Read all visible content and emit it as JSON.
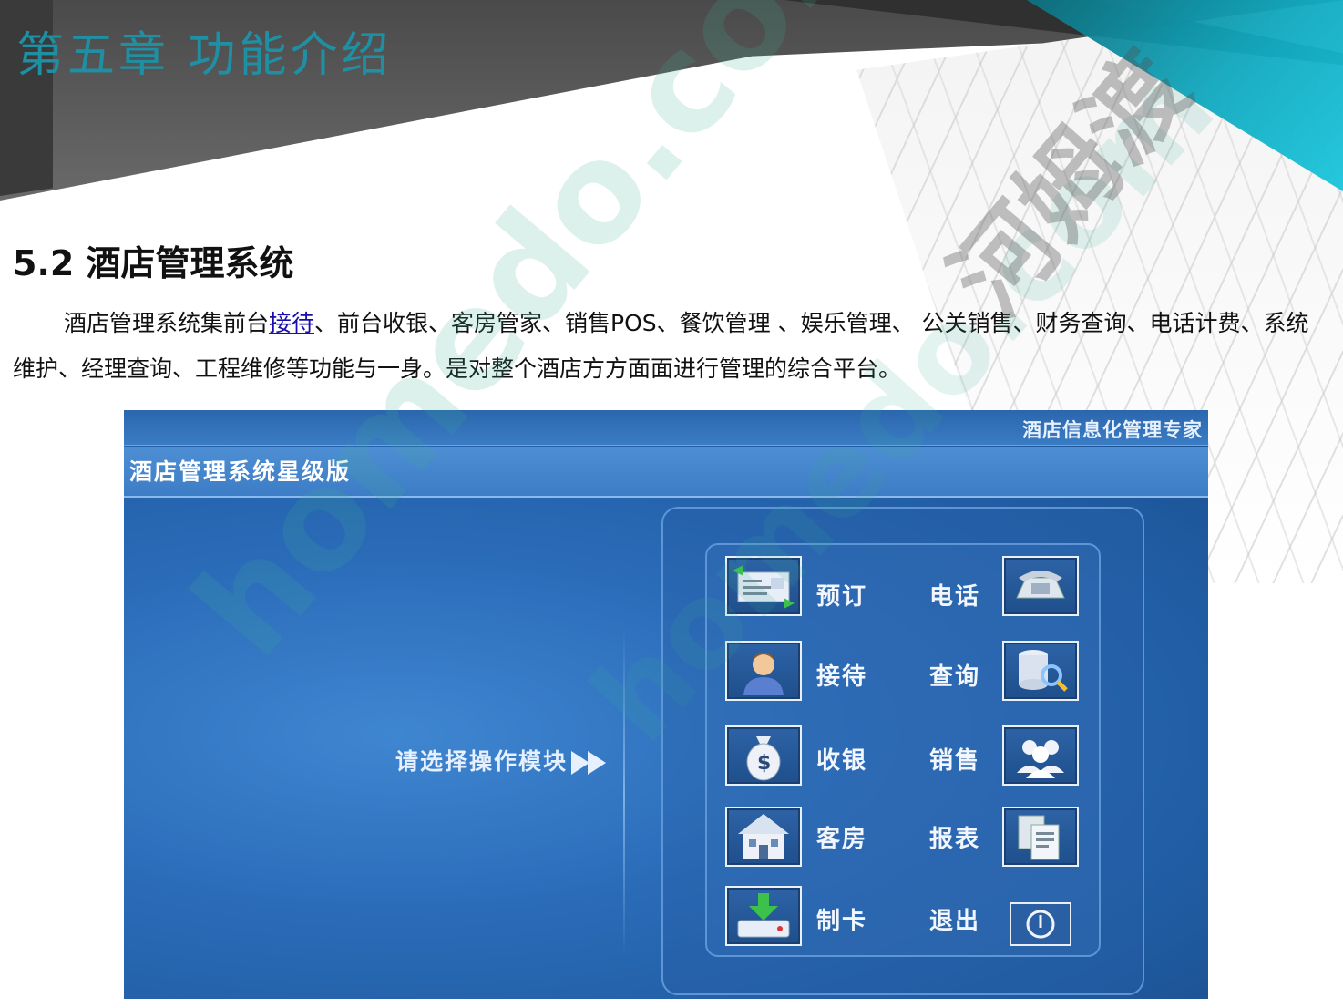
{
  "header": {
    "chapter_title": "第五章  功能介绍"
  },
  "section": {
    "title": "5.2 酒店管理系统",
    "para_before_link": "酒店管理系统集前台",
    "para_link": "接待",
    "para_after_link": "、前台收银、客房管家、销售POS、餐饮管理 、娱乐管理、 公关销售、财务查询、电话计费、系统维护、经理查询、工程维修等功能与一身。是对整个酒店方方面面进行管理的综合平台。"
  },
  "app": {
    "slogan": "酒店信息化管理专家",
    "title": "酒店管理系统星级版",
    "prompt": "请选择操作模块",
    "modules_left": [
      {
        "label": "预订",
        "icon": "reservation-icon"
      },
      {
        "label": "接待",
        "icon": "reception-icon"
      },
      {
        "label": "收银",
        "icon": "money-bag-icon"
      },
      {
        "label": "客房",
        "icon": "house-icon"
      },
      {
        "label": "制卡",
        "icon": "card-download-icon"
      }
    ],
    "modules_right": [
      {
        "label": "电话",
        "icon": "telephone-icon"
      },
      {
        "label": "查询",
        "icon": "database-search-icon"
      },
      {
        "label": "销售",
        "icon": "users-icon"
      },
      {
        "label": "报表",
        "icon": "report-icon"
      },
      {
        "label": "退出",
        "icon": "power-icon"
      }
    ]
  },
  "watermark": {
    "text": "homedo.com",
    "brand_cn": "河姆渡"
  }
}
